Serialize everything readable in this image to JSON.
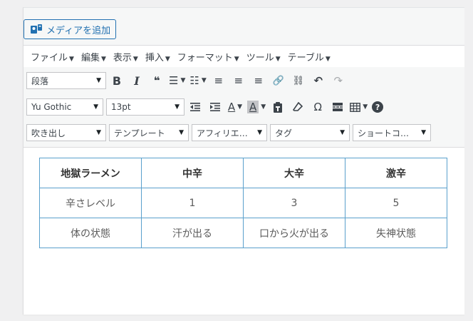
{
  "media": {
    "add_label": "メディアを追加"
  },
  "menubar": {
    "items": [
      {
        "label": "ファイル"
      },
      {
        "label": "編集"
      },
      {
        "label": "表示"
      },
      {
        "label": "挿入"
      },
      {
        "label": "フォーマット"
      },
      {
        "label": "ツール"
      },
      {
        "label": "テーブル"
      }
    ]
  },
  "toolbar": {
    "paragraph_select": "段落",
    "bold": "B",
    "italic": "I",
    "blockquote": "❝",
    "ul_icon": "☰",
    "ol_icon": "☷",
    "align_left": "≡",
    "align_center": "≡",
    "align_right": "≡",
    "link_icon": "🔗",
    "unlink_icon": "⛓",
    "undo": "↶",
    "redo": "↷",
    "font_select": "Yu Gothic",
    "size_select": "13pt",
    "text_color": "A",
    "bg_color": "A",
    "omega": "Ω",
    "help": "?",
    "balloon_select": "吹き出し",
    "template_select": "テンプレート",
    "affiliate_select": "アフィリエ…",
    "tag_select": "タグ",
    "shortcode_select": "ショートコ…"
  },
  "table": {
    "header": [
      "地獄ラーメン",
      "中辛",
      "大辛",
      "激辛"
    ],
    "rows": [
      [
        "辛さレベル",
        "1",
        "3",
        "5"
      ],
      [
        "体の状態",
        "汗が出る",
        "口から火が出る",
        "失神状態"
      ]
    ]
  },
  "colors": {
    "accent": "#2271b1",
    "table_border": "#5aa0cc"
  }
}
